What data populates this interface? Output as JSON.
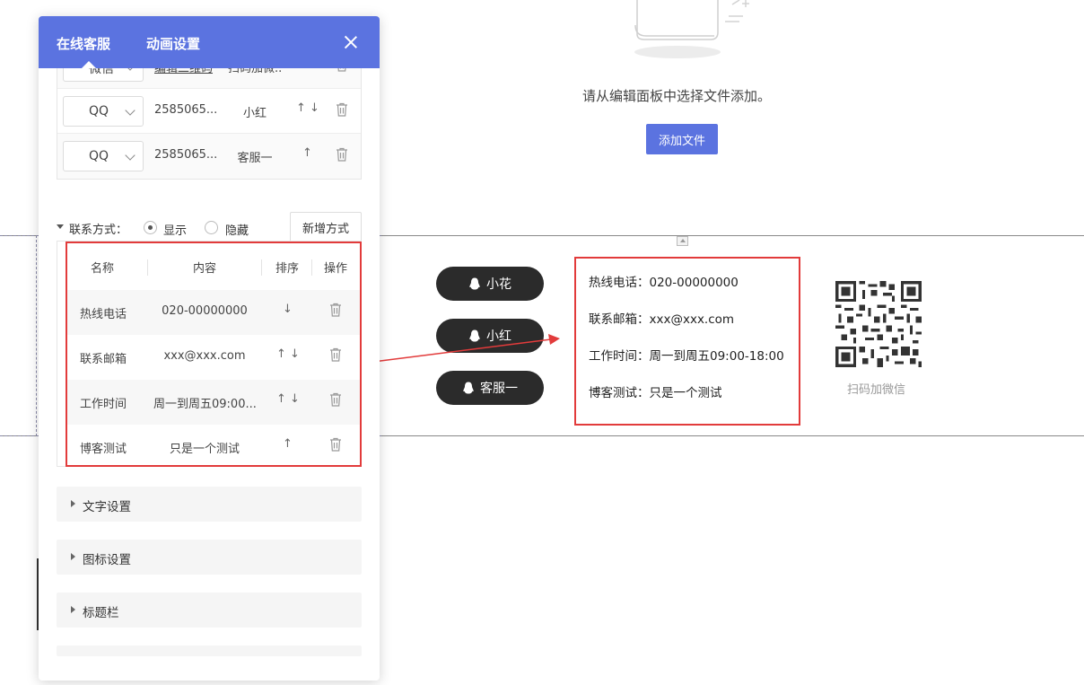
{
  "canvas": {
    "empty_message": "请从编辑面板中选择文件添加。",
    "add_file_label": "添加文件",
    "service_pills": [
      {
        "label": "小花"
      },
      {
        "label": "小红"
      },
      {
        "label": "客服一"
      }
    ],
    "contact_lines": [
      "热线电话：020-00000000",
      "联系邮箱：xxx@xxx.com",
      "工作时间：周一到周五09:00-18:00",
      "博客测试：只是一个测试"
    ],
    "qr_caption": "扫码加微信",
    "accent_color": "#5b73e0",
    "highlight_color": "#e23b3b"
  },
  "panel": {
    "tabs": [
      {
        "label": "在线客服",
        "active": true
      },
      {
        "label": "动画设置",
        "active": false
      }
    ],
    "channel_rows": [
      {
        "type": "微信",
        "account": "编辑二维码",
        "name": "扫码加微...",
        "sort": "↑ ↓"
      },
      {
        "type": "QQ",
        "account": "2585065...",
        "name": "小红",
        "sort": "↑ ↓"
      },
      {
        "type": "QQ",
        "account": "2585065...",
        "name": "客服一",
        "sort": "↑"
      }
    ],
    "contact_section": {
      "label": "联系方式：",
      "show_label": "显示",
      "hide_label": "隐藏",
      "selected": "显示",
      "new_button": "新增方式"
    },
    "contact_table": {
      "headers": [
        "名称",
        "内容",
        "排序",
        "操作"
      ],
      "rows": [
        {
          "name": "热线电话",
          "content": "020-00000000",
          "sort": "↓"
        },
        {
          "name": "联系邮箱",
          "content": "xxx@xxx.com",
          "sort": "↑ ↓"
        },
        {
          "name": "工作时间",
          "content": "周一到周五09:00...",
          "sort": "↑ ↓"
        },
        {
          "name": "博客测试",
          "content": "只是一个测试",
          "sort": "↑"
        }
      ]
    },
    "collapse_sections": [
      {
        "label": "文字设置"
      },
      {
        "label": "图标设置"
      },
      {
        "label": "标题栏"
      }
    ]
  }
}
